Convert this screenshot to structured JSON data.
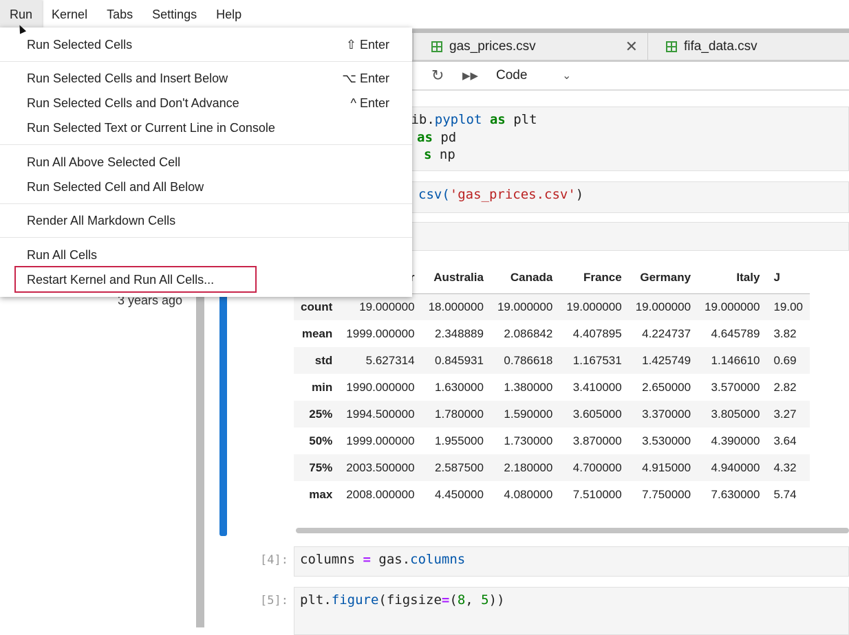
{
  "menubar": {
    "items": [
      "Run",
      "Kernel",
      "Tabs",
      "Settings",
      "Help"
    ]
  },
  "sidebar": {
    "modified": "3 years ago"
  },
  "tabs": [
    {
      "label": "gas_prices.csv",
      "icon": "spreadsheet-icon"
    },
    {
      "label": "fifa_data.csv",
      "icon": "spreadsheet-icon"
    }
  ],
  "toolbar": {
    "cell_type": "Code"
  },
  "cells": {
    "c1": {
      "l1a": "lib.",
      "l1b": "pyplot",
      "l1c": "as",
      "l1d": " plt",
      "l2a": "as",
      "l2b": " pd",
      "l3a": "s",
      "l3b": " np"
    },
    "c2": {
      "a": "csv(",
      "b": "'gas_prices.csv'",
      "c": ")"
    },
    "c4": {
      "prompt": "[4]:",
      "a": "columns ",
      "op": "=",
      "b": " gas.",
      "c": "columns"
    },
    "c5": {
      "prompt": "[5]:",
      "a": "plt.",
      "b": "figure",
      "c": "(figsize",
      "op": "=",
      "d": "(",
      "n1": "8",
      ", ": ", ",
      "n2": "5",
      "e": "))"
    }
  },
  "table": {
    "columns": [
      "",
      "Year",
      "Australia",
      "Canada",
      "France",
      "Germany",
      "Italy",
      "J"
    ],
    "rows": [
      [
        "count",
        "19.000000",
        "18.000000",
        "19.000000",
        "19.000000",
        "19.000000",
        "19.000000",
        "19.00"
      ],
      [
        "mean",
        "1999.000000",
        "2.348889",
        "2.086842",
        "4.407895",
        "4.224737",
        "4.645789",
        "3.82"
      ],
      [
        "std",
        "5.627314",
        "0.845931",
        "0.786618",
        "1.167531",
        "1.425749",
        "1.146610",
        "0.69"
      ],
      [
        "min",
        "1990.000000",
        "1.630000",
        "1.380000",
        "3.410000",
        "2.650000",
        "3.570000",
        "2.82"
      ],
      [
        "25%",
        "1994.500000",
        "1.780000",
        "1.590000",
        "3.605000",
        "3.370000",
        "3.805000",
        "3.27"
      ],
      [
        "50%",
        "1999.000000",
        "1.955000",
        "1.730000",
        "3.870000",
        "3.530000",
        "4.390000",
        "3.64"
      ],
      [
        "75%",
        "2003.500000",
        "2.587500",
        "2.180000",
        "4.700000",
        "4.915000",
        "4.940000",
        "4.32"
      ],
      [
        "max",
        "2008.000000",
        "4.450000",
        "4.080000",
        "7.510000",
        "7.750000",
        "7.630000",
        "5.74"
      ]
    ]
  },
  "run_menu": {
    "items": [
      {
        "label": "Run Selected Cells",
        "shortcut": "⇧ Enter"
      },
      {
        "label": "Run Selected Cells and Insert Below",
        "shortcut": "⌥ Enter"
      },
      {
        "label": "Run Selected Cells and Don't Advance",
        "shortcut": "^ Enter"
      },
      {
        "label": "Run Selected Text or Current Line in Console",
        "shortcut": ""
      },
      {
        "label": "Run All Above Selected Cell",
        "shortcut": ""
      },
      {
        "label": "Run Selected Cell and All Below",
        "shortcut": ""
      },
      {
        "label": "Render All Markdown Cells",
        "shortcut": ""
      },
      {
        "label": "Run All Cells",
        "shortcut": ""
      },
      {
        "label": "Restart Kernel and Run All Cells...",
        "shortcut": ""
      }
    ]
  },
  "colors": {
    "highlight_box": "#c8244a",
    "active_cell": "#1976d2"
  }
}
